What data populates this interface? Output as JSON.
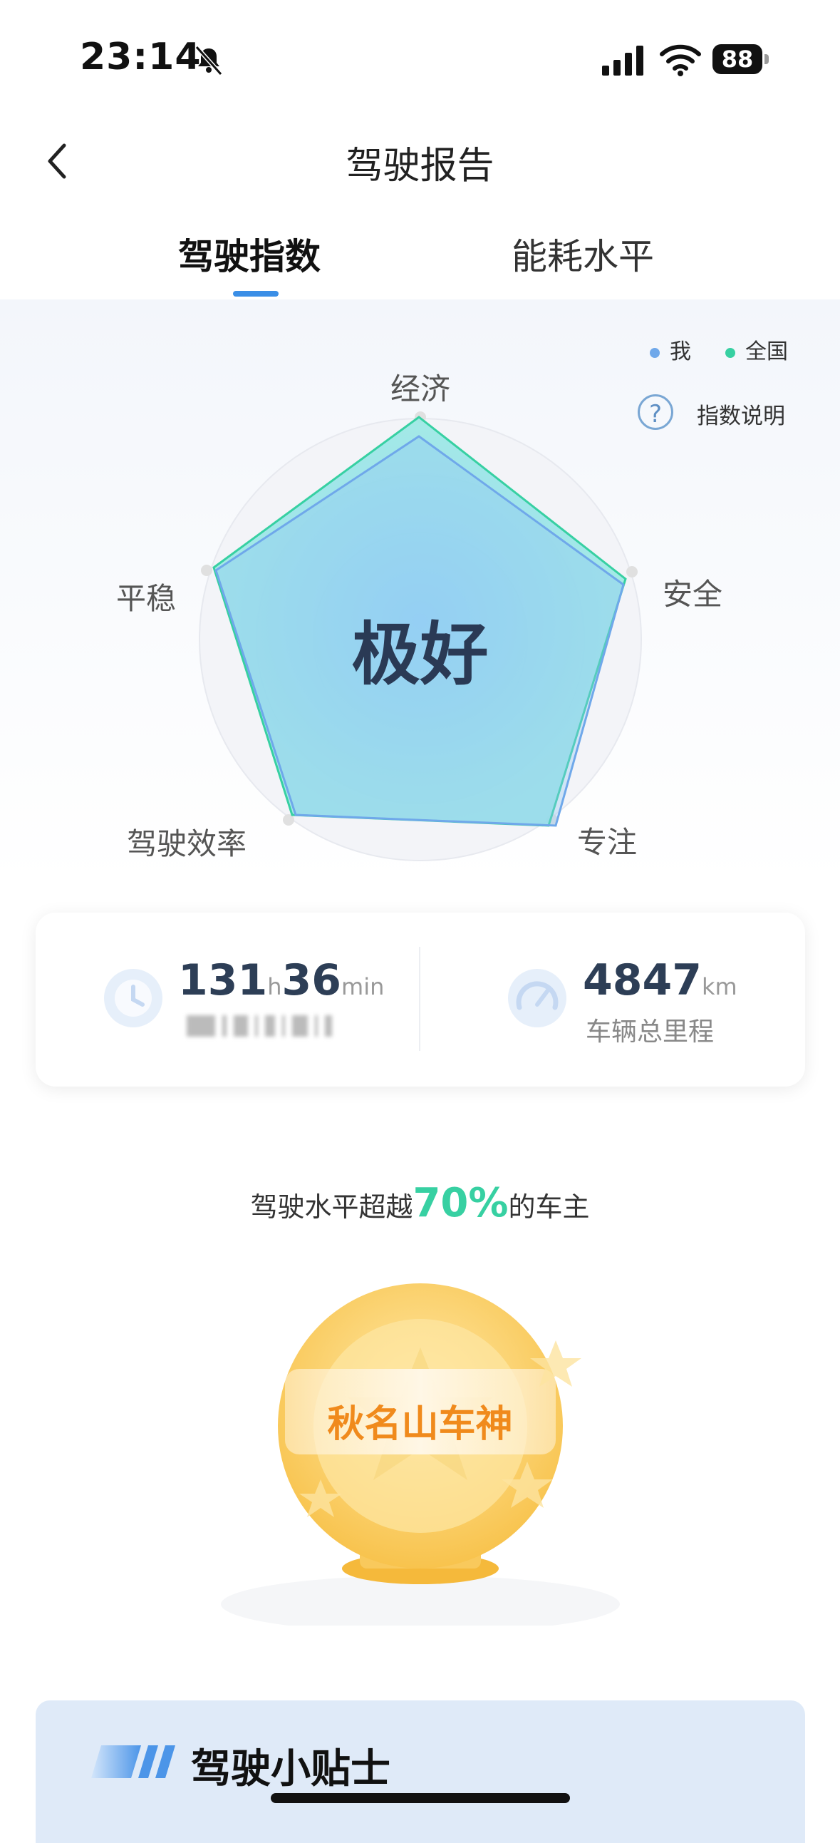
{
  "status_bar": {
    "time": "23:14",
    "battery": "88"
  },
  "nav": {
    "title": "驾驶报告"
  },
  "tabs": [
    {
      "label": "驾驶指数"
    },
    {
      "label": "能耗水平"
    }
  ],
  "legend": {
    "me": "我",
    "national": "全国"
  },
  "help": {
    "icon_text": "?",
    "label": "指数说明"
  },
  "radar": {
    "axes": [
      "经济",
      "安全",
      "专注",
      "驾驶效率",
      "平稳"
    ],
    "rating": "极好",
    "colors": {
      "me": "#6fa8ea",
      "national": "#37d0a2"
    }
  },
  "stats": {
    "time_hours": "131",
    "time_hours_unit": "h",
    "time_minutes": "36",
    "time_minutes_unit": "min",
    "mileage": "4847",
    "mileage_unit": "km",
    "mileage_label": "车辆总里程"
  },
  "rank": {
    "prefix": "驾驶水平超越",
    "percent": "70%",
    "suffix": "的车主"
  },
  "medal": {
    "title": "秋名山车神"
  },
  "tips": {
    "title": "驾驶小贴士"
  }
}
